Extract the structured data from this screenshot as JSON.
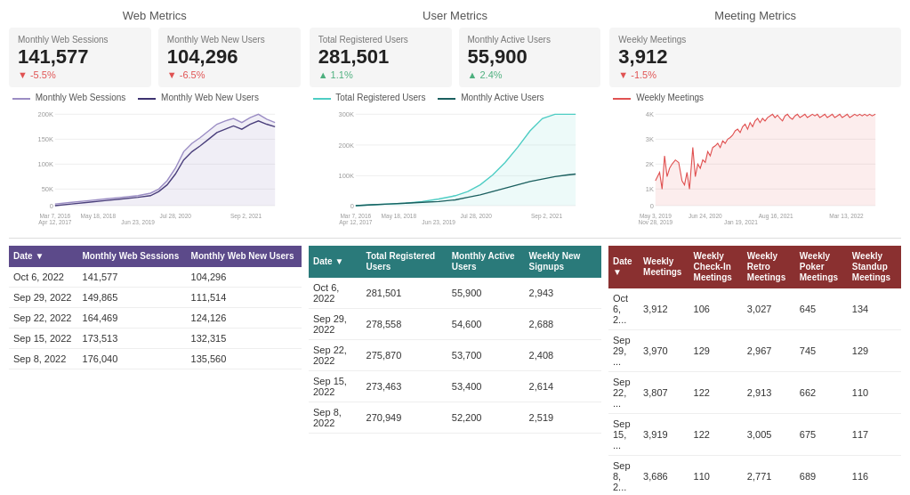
{
  "panels": [
    {
      "title": "Web Metrics",
      "cards": [
        {
          "label": "Monthly Web Sessions",
          "value": "141,577",
          "change": "▼ -5.5%",
          "change_type": "down"
        },
        {
          "label": "Monthly Web New Users",
          "value": "104,296",
          "change": "▼ -6.5%",
          "change_type": "down"
        }
      ],
      "legend": [
        {
          "label": "Monthly Web Sessions",
          "color": "#9b8dc4",
          "dash": false
        },
        {
          "label": "Monthly Web New Users",
          "color": "#3d3270",
          "dash": true
        }
      ],
      "chart": {
        "x_labels": [
          "Mar 7, 2016",
          "May 18, 2018",
          "Jul 28, 2020",
          "Apr 12, 2017",
          "Jun 23, 2019",
          "Sep 2, 2021"
        ],
        "y_labels": [
          "200K",
          "150K",
          "100K",
          "50K",
          "0"
        ],
        "y_axis_labels_left": [
          "200K",
          "150K",
          "100K",
          "50K",
          "0"
        ],
        "x_axis_labels": [
          "Mar 7, 2016",
          "Apr 12, 2017",
          "May 18, 2018",
          "Jun 23, 2019",
          "Jul 28, 2020",
          "Sep 2, 2021"
        ]
      }
    },
    {
      "title": "User Metrics",
      "cards": [
        {
          "label": "Total Registered Users",
          "value": "281,501",
          "change": "▲ 1.1%",
          "change_type": "up"
        },
        {
          "label": "Monthly Active Users",
          "value": "55,900",
          "change": "▲ 2.4%",
          "change_type": "up"
        }
      ],
      "legend": [
        {
          "label": "Total Registered Users",
          "color": "#4ecdc4",
          "dash": false
        },
        {
          "label": "Monthly Active Users",
          "color": "#1a5f5f",
          "dash": false
        }
      ],
      "chart": {
        "x_axis_labels": [
          "Mar 7, 2016",
          "Apr 12, 2017",
          "May 18, 2018",
          "Jun 23, 2019",
          "Jul 28, 2020",
          "Sep 2, 2021"
        ],
        "y_axis_labels_left": [
          "300K",
          "200K",
          "100K",
          "0"
        ]
      }
    },
    {
      "title": "Meeting Metrics",
      "cards": [
        {
          "label": "Weekly Meetings",
          "value": "3,912",
          "change": "▼ -1.5%",
          "change_type": "down"
        }
      ],
      "legend": [
        {
          "label": "Weekly Meetings",
          "color": "#e05252",
          "dash": false
        }
      ],
      "chart": {
        "x_axis_labels": [
          "May 3, 2019",
          "Nov 28, 2019",
          "Jun 24, 2020",
          "Jan 19, 2021",
          "Aug 16, 2021",
          "Mar 13, 2022"
        ],
        "y_axis_labels_left": [
          "4K",
          "3K",
          "2K",
          "1K",
          "0"
        ]
      }
    }
  ],
  "tables": [
    {
      "theme": "purple",
      "columns": [
        "Date ▼",
        "Monthly Web Sessions",
        "Monthly Web New Users"
      ],
      "rows": [
        [
          "Oct 6, 2022",
          "141,577",
          "104,296"
        ],
        [
          "Sep 29, 2022",
          "149,865",
          "111,514"
        ],
        [
          "Sep 22, 2022",
          "164,469",
          "124,126"
        ],
        [
          "Sep 15, 2022",
          "173,513",
          "132,315"
        ],
        [
          "Sep 8, 2022",
          "176,040",
          "135,560"
        ]
      ]
    },
    {
      "theme": "teal",
      "columns": [
        "Date ▼",
        "Total Registered Users",
        "Monthly Active Users",
        "Weekly New Signups"
      ],
      "rows": [
        [
          "Oct 6, 2022",
          "281,501",
          "55,900",
          "2,943"
        ],
        [
          "Sep 29, 2022",
          "278,558",
          "54,600",
          "2,688"
        ],
        [
          "Sep 22, 2022",
          "275,870",
          "53,700",
          "2,408"
        ],
        [
          "Sep 15, 2022",
          "273,463",
          "53,400",
          "2,614"
        ],
        [
          "Sep 8, 2022",
          "270,949",
          "52,200",
          "2,519"
        ]
      ]
    },
    {
      "theme": "red",
      "columns": [
        "Date ▼",
        "Weekly Meetings",
        "Weekly Check-In Meetings",
        "Weekly Retro Meetings",
        "Weekly Poker Meetings",
        "Weekly Standup Meetings"
      ],
      "rows": [
        [
          "Oct 6, 2...",
          "3,912",
          "106",
          "3,027",
          "645",
          "134"
        ],
        [
          "Sep 29, ...",
          "3,970",
          "129",
          "2,967",
          "745",
          "129"
        ],
        [
          "Sep 22, ...",
          "3,807",
          "122",
          "2,913",
          "662",
          "110"
        ],
        [
          "Sep 15, ...",
          "3,919",
          "122",
          "3,005",
          "675",
          "117"
        ],
        [
          "Sep 8, 2...",
          "3,686",
          "110",
          "2,771",
          "689",
          "116"
        ]
      ]
    }
  ]
}
